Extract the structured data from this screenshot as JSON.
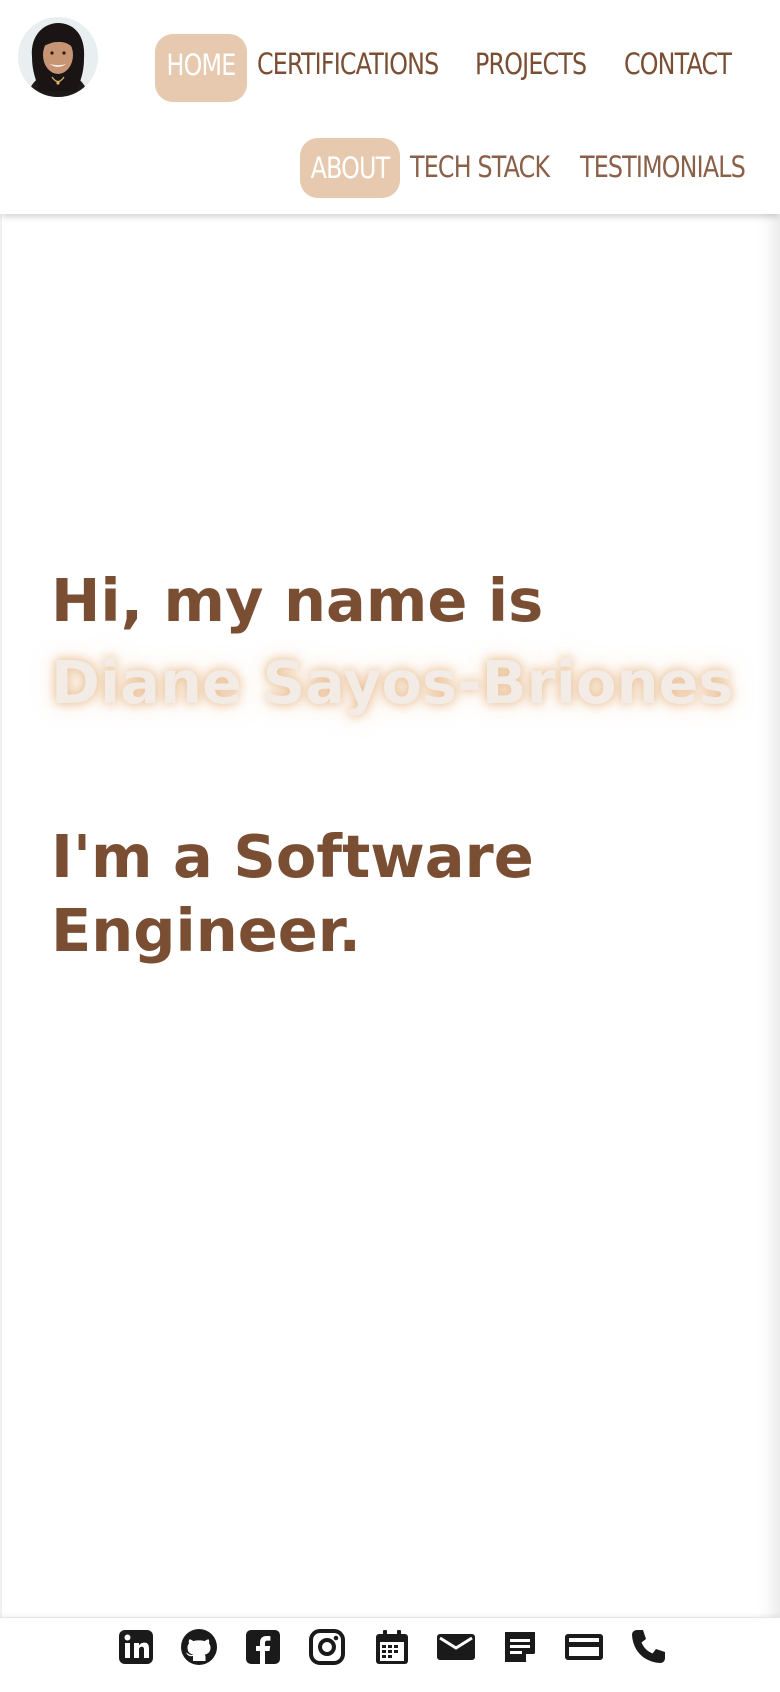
{
  "nav": {
    "home_label": "HOME",
    "certifications_label": "CERTIFICATIONS",
    "projects_label": "PROJECTS",
    "contact_label": "CONTACT"
  },
  "subnav": {
    "about_label": "ABOUT",
    "techstack_label": "TECH STACK",
    "testimonials_label": "TESTIMONIALS"
  },
  "hero": {
    "greeting": "Hi, my name is ",
    "name": "Diane Sayos-Briones",
    "role": "I'm a Software Engineer."
  },
  "footer": {
    "icons": [
      "linkedin-icon",
      "github-icon",
      "facebook-icon",
      "instagram-icon",
      "calendar-icon",
      "email-icon",
      "notes-icon",
      "credit-card-icon",
      "phone-icon"
    ]
  },
  "colors": {
    "brand_brown": "#7a4e33",
    "accent_tan": "#e6c9ae",
    "name_glow": "#f3ece6"
  }
}
